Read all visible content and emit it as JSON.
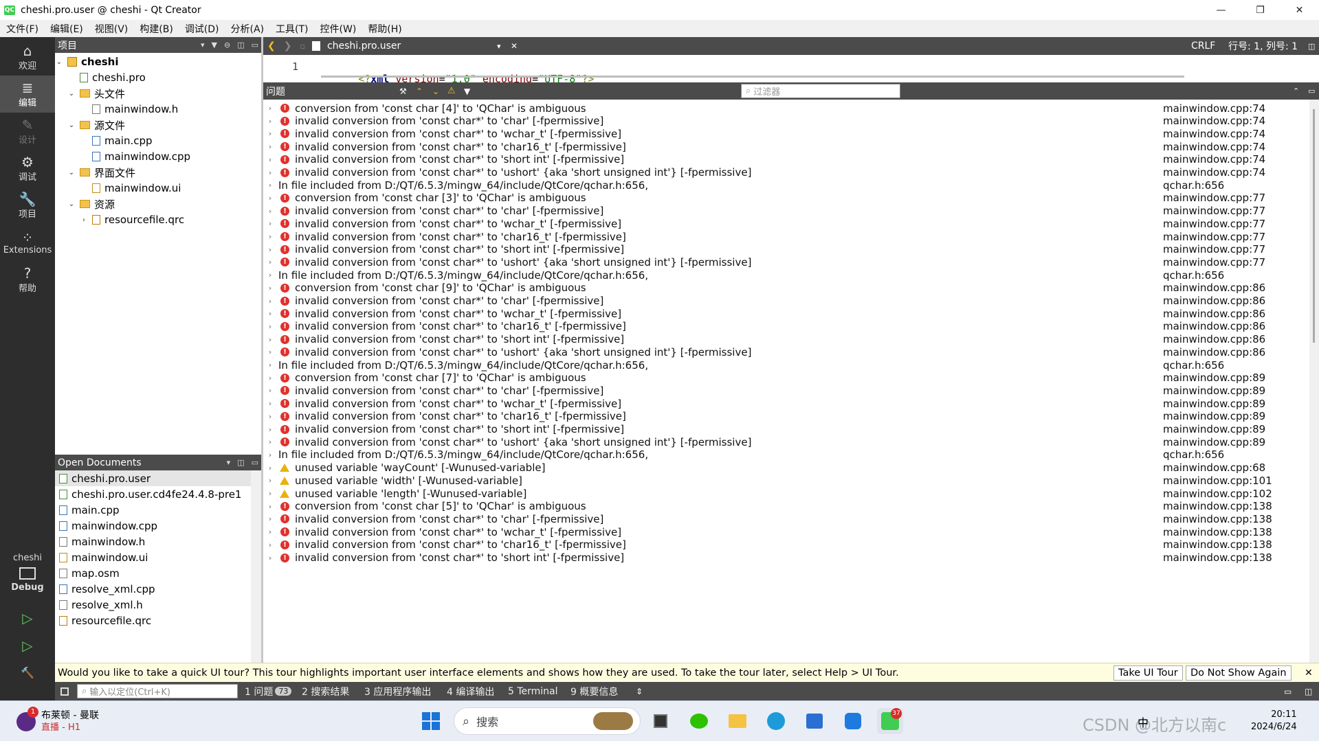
{
  "window": {
    "title": "cheshi.pro.user @ cheshi - Qt Creator",
    "app_icon": "QC",
    "minimize": "—",
    "restore": "❐",
    "close": "✕"
  },
  "menu": [
    "文件(F)",
    "编辑(E)",
    "视图(V)",
    "构建(B)",
    "调试(D)",
    "分析(A)",
    "工具(T)",
    "控件(W)",
    "帮助(H)"
  ],
  "modes": [
    {
      "label": "欢迎",
      "icon": "⌂"
    },
    {
      "label": "编辑",
      "icon": "≣"
    },
    {
      "label": "设计",
      "icon": "✎"
    },
    {
      "label": "调试",
      "icon": "⚙"
    },
    {
      "label": "项目",
      "icon": "🔧"
    },
    {
      "label": "Extensions",
      "icon": "⁘"
    },
    {
      "label": "帮助",
      "icon": "?"
    }
  ],
  "kit": {
    "project": "cheshi",
    "config": "Debug",
    "run": "▷",
    "debug_run": "▷",
    "build": "🔨"
  },
  "projects_pane": {
    "title": "项目"
  },
  "tree": [
    {
      "label": "cheshi",
      "level": 0,
      "arrow": "⌄",
      "type": "project"
    },
    {
      "label": "cheshi.pro",
      "level": 1,
      "arrow": "",
      "type": "pro"
    },
    {
      "label": "头文件",
      "level": 1,
      "arrow": "⌄",
      "type": "folder"
    },
    {
      "label": "mainwindow.h",
      "level": 2,
      "arrow": "",
      "type": "h"
    },
    {
      "label": "源文件",
      "level": 1,
      "arrow": "⌄",
      "type": "folder"
    },
    {
      "label": "main.cpp",
      "level": 2,
      "arrow": "",
      "type": "cpp"
    },
    {
      "label": "mainwindow.cpp",
      "level": 2,
      "arrow": "",
      "type": "cpp"
    },
    {
      "label": "界面文件",
      "level": 1,
      "arrow": "⌄",
      "type": "folder"
    },
    {
      "label": "mainwindow.ui",
      "level": 2,
      "arrow": "",
      "type": "ui"
    },
    {
      "label": "资源",
      "level": 1,
      "arrow": "⌄",
      "type": "folder"
    },
    {
      "label": "resourcefile.qrc",
      "level": 2,
      "arrow": "›",
      "type": "qrc"
    }
  ],
  "open_documents": {
    "title": "Open Documents",
    "items": [
      {
        "label": "cheshi.pro.user",
        "type": "pro",
        "selected": true
      },
      {
        "label": "cheshi.pro.user.cd4fe24.4.8-pre1",
        "type": "pro"
      },
      {
        "label": "main.cpp",
        "type": "cpp"
      },
      {
        "label": "mainwindow.cpp",
        "type": "cpp"
      },
      {
        "label": "mainwindow.h",
        "type": "h"
      },
      {
        "label": "mainwindow.ui",
        "type": "ui"
      },
      {
        "label": "map.osm",
        "type": "file"
      },
      {
        "label": "resolve_xml.cpp",
        "type": "cpp"
      },
      {
        "label": "resolve_xml.h",
        "type": "h"
      },
      {
        "label": "resourcefile.qrc",
        "type": "qrc"
      }
    ]
  },
  "editor": {
    "file_tab": "cheshi.pro.user",
    "line_ending": "CRLF",
    "cursor": "行号: 1, 列号: 1",
    "line_number": "1",
    "code_tag_open": "<?",
    "code_xml": "xml",
    "code_attr1": "version",
    "code_val1": "\"1.0\"",
    "code_attr2": "encoding",
    "code_val2": "\"UTF-8\"",
    "code_tag_close": "?>"
  },
  "issues_pane": {
    "title": "问题",
    "filter_placeholder": "过滤器"
  },
  "issues": [
    {
      "sev": "error",
      "msg": "conversion from 'const char [4]' to 'QChar' is ambiguous",
      "loc": "mainwindow.cpp:74"
    },
    {
      "sev": "error",
      "msg": "invalid conversion from 'const char*' to 'char' [-fpermissive]",
      "loc": "mainwindow.cpp:74"
    },
    {
      "sev": "error",
      "msg": "invalid conversion from 'const char*' to 'wchar_t' [-fpermissive]",
      "loc": "mainwindow.cpp:74"
    },
    {
      "sev": "error",
      "msg": "invalid conversion from 'const char*' to 'char16_t' [-fpermissive]",
      "loc": "mainwindow.cpp:74"
    },
    {
      "sev": "error",
      "msg": "invalid conversion from 'const char*' to 'short int' [-fpermissive]",
      "loc": "mainwindow.cpp:74"
    },
    {
      "sev": "error",
      "msg": "invalid conversion from 'const char*' to 'ushort' {aka 'short unsigned int'} [-fpermissive]",
      "loc": "mainwindow.cpp:74"
    },
    {
      "sev": "none",
      "msg": "In file included from D:/QT/6.5.3/mingw_64/include/QtCore/qchar.h:656,",
      "loc": "qchar.h:656"
    },
    {
      "sev": "error",
      "msg": "conversion from 'const char [3]' to 'QChar' is ambiguous",
      "loc": "mainwindow.cpp:77"
    },
    {
      "sev": "error",
      "msg": "invalid conversion from 'const char*' to 'char' [-fpermissive]",
      "loc": "mainwindow.cpp:77"
    },
    {
      "sev": "error",
      "msg": "invalid conversion from 'const char*' to 'wchar_t' [-fpermissive]",
      "loc": "mainwindow.cpp:77"
    },
    {
      "sev": "error",
      "msg": "invalid conversion from 'const char*' to 'char16_t' [-fpermissive]",
      "loc": "mainwindow.cpp:77"
    },
    {
      "sev": "error",
      "msg": "invalid conversion from 'const char*' to 'short int' [-fpermissive]",
      "loc": "mainwindow.cpp:77"
    },
    {
      "sev": "error",
      "msg": "invalid conversion from 'const char*' to 'ushort' {aka 'short unsigned int'} [-fpermissive]",
      "loc": "mainwindow.cpp:77"
    },
    {
      "sev": "none",
      "msg": "In file included from D:/QT/6.5.3/mingw_64/include/QtCore/qchar.h:656,",
      "loc": "qchar.h:656"
    },
    {
      "sev": "error",
      "msg": "conversion from 'const char [9]' to 'QChar' is ambiguous",
      "loc": "mainwindow.cpp:86"
    },
    {
      "sev": "error",
      "msg": "invalid conversion from 'const char*' to 'char' [-fpermissive]",
      "loc": "mainwindow.cpp:86"
    },
    {
      "sev": "error",
      "msg": "invalid conversion from 'const char*' to 'wchar_t' [-fpermissive]",
      "loc": "mainwindow.cpp:86"
    },
    {
      "sev": "error",
      "msg": "invalid conversion from 'const char*' to 'char16_t' [-fpermissive]",
      "loc": "mainwindow.cpp:86"
    },
    {
      "sev": "error",
      "msg": "invalid conversion from 'const char*' to 'short int' [-fpermissive]",
      "loc": "mainwindow.cpp:86"
    },
    {
      "sev": "error",
      "msg": "invalid conversion from 'const char*' to 'ushort' {aka 'short unsigned int'} [-fpermissive]",
      "loc": "mainwindow.cpp:86"
    },
    {
      "sev": "none",
      "msg": "In file included from D:/QT/6.5.3/mingw_64/include/QtCore/qchar.h:656,",
      "loc": "qchar.h:656"
    },
    {
      "sev": "error",
      "msg": "conversion from 'const char [7]' to 'QChar' is ambiguous",
      "loc": "mainwindow.cpp:89"
    },
    {
      "sev": "error",
      "msg": "invalid conversion from 'const char*' to 'char' [-fpermissive]",
      "loc": "mainwindow.cpp:89"
    },
    {
      "sev": "error",
      "msg": "invalid conversion from 'const char*' to 'wchar_t' [-fpermissive]",
      "loc": "mainwindow.cpp:89"
    },
    {
      "sev": "error",
      "msg": "invalid conversion from 'const char*' to 'char16_t' [-fpermissive]",
      "loc": "mainwindow.cpp:89"
    },
    {
      "sev": "error",
      "msg": "invalid conversion from 'const char*' to 'short int' [-fpermissive]",
      "loc": "mainwindow.cpp:89"
    },
    {
      "sev": "error",
      "msg": "invalid conversion from 'const char*' to 'ushort' {aka 'short unsigned int'} [-fpermissive]",
      "loc": "mainwindow.cpp:89"
    },
    {
      "sev": "none",
      "msg": "In file included from D:/QT/6.5.3/mingw_64/include/QtCore/qchar.h:656,",
      "loc": "qchar.h:656"
    },
    {
      "sev": "warning",
      "msg": "unused variable 'wayCount' [-Wunused-variable]",
      "loc": "mainwindow.cpp:68"
    },
    {
      "sev": "warning",
      "msg": "unused variable 'width' [-Wunused-variable]",
      "loc": "mainwindow.cpp:101"
    },
    {
      "sev": "warning",
      "msg": "unused variable 'length' [-Wunused-variable]",
      "loc": "mainwindow.cpp:102"
    },
    {
      "sev": "error",
      "msg": "conversion from 'const char [5]' to 'QChar' is ambiguous",
      "loc": "mainwindow.cpp:138"
    },
    {
      "sev": "error",
      "msg": "invalid conversion from 'const char*' to 'char' [-fpermissive]",
      "loc": "mainwindow.cpp:138"
    },
    {
      "sev": "error",
      "msg": "invalid conversion from 'const char*' to 'wchar_t' [-fpermissive]",
      "loc": "mainwindow.cpp:138"
    },
    {
      "sev": "error",
      "msg": "invalid conversion from 'const char*' to 'char16_t' [-fpermissive]",
      "loc": "mainwindow.cpp:138"
    },
    {
      "sev": "error",
      "msg": "invalid conversion from 'const char*' to 'short int' [-fpermissive]",
      "loc": "mainwindow.cpp:138"
    }
  ],
  "tour": {
    "message": "Would you like to take a quick UI tour? This tour highlights important user interface elements and shows how they are used. To take the tour later, select Help > UI Tour.",
    "take": "Take UI Tour",
    "dismiss": "Do Not Show Again"
  },
  "output_bar": {
    "locator_placeholder": "输入以定位(Ctrl+K)",
    "tabs": [
      "1 问题",
      "2 搜索结果",
      "3 应用程序输出",
      "4 编译输出",
      "5 Terminal",
      "9 概要信息"
    ],
    "issues_count": "73"
  },
  "taskbar": {
    "media_title": "布莱顿 - 曼联",
    "media_sub": "直播 - H1",
    "media_badge": "1",
    "search_placeholder": "搜索",
    "qt_badge": "37",
    "ime": "中",
    "time": "20:11",
    "date": "2024/6/24",
    "watermark": "CSDN @北方以南c"
  },
  "colors": {
    "dark_panel": "#2d2d2d",
    "header": "#4b4b4b",
    "error": "#e0312b",
    "warning": "#e8b20d",
    "tour_bg": "#fffde0"
  }
}
